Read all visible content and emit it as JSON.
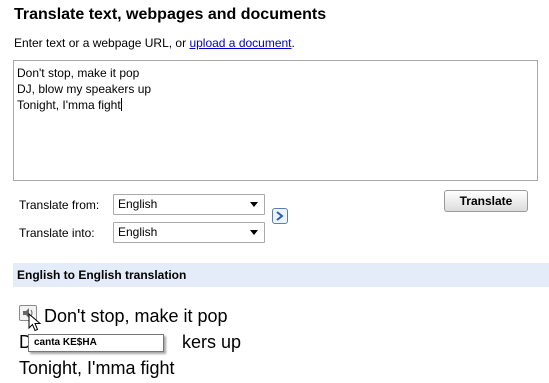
{
  "header": {
    "title": "Translate text, webpages and documents",
    "subtitle_prefix": "Enter text or a webpage URL, or ",
    "upload_link": "upload a document",
    "subtitle_suffix": "."
  },
  "source_text": "Don't stop, make it pop\nDJ, blow my speakers up\nTonight, I'mma fight",
  "controls": {
    "translate_from_label": "Translate from:",
    "translate_from_value": "English",
    "translate_into_label": "Translate into:",
    "translate_into_value": "English",
    "translate_button": "Translate",
    "swap_icon": "swap-arrow-icon"
  },
  "result": {
    "heading": "English to English translation",
    "lines": [
      "Don't stop, make it pop",
      "DJ, blow my speakers up",
      "Tonight, I'mma fight"
    ],
    "visible_line2_fragment": "kers up",
    "speaker_icon": "speaker-icon"
  },
  "tooltip": {
    "text": "canta KE$HA"
  },
  "colors": {
    "link": "#0000cc",
    "result_bar": "#e5ecf9",
    "swap_border": "#5b7fb5"
  }
}
